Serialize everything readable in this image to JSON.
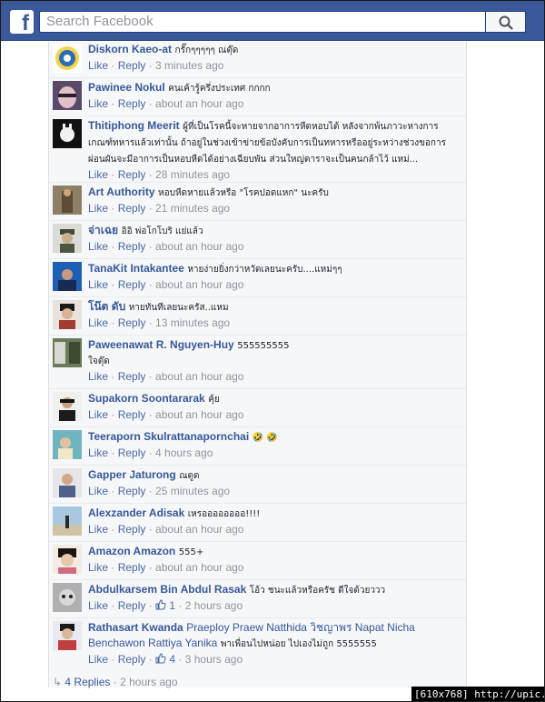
{
  "header": {
    "logo": "f",
    "search_placeholder": "Search Facebook"
  },
  "comments": [
    {
      "author": "Diskorn Kaeo-at",
      "text": "กรั๊กๆๆๆๆๆ ณตุ๊ด",
      "like": "Like",
      "reply": "Reply",
      "time": "3 minutes ago"
    },
    {
      "author": "Pawinee Nokul",
      "text": "คนเค้ารู้ครึ่งประเทศ กกกก",
      "like": "Like",
      "reply": "Reply",
      "time": "about an hour ago"
    },
    {
      "author": "Thitiphong Meerit",
      "text": "ผู้ที่เป็นโรคนี้จะหายจากอาการหืดหอบได้ หลังจากพ้นภาวะหางการเกณฑ์ทหารแล้วเท่านั้น ถ้าอยู่ในช่วงเข้าข่ายข้อบังคับการเป็นทหารหรืออยู่ระหว่างช่วงขอการผ่อนผันจะมีอาการเป็นหอบหืดได้อย่างเฉียบพัน ส่วนใหญ่ดาราจะเป็นคนกล้าไว้ แหม่...",
      "like": "Like",
      "reply": "Reply",
      "time": "28 minutes ago"
    },
    {
      "author": "Art Authority",
      "text": "หอบหืดหายแล้วหรือ \"โรคปอดแหก\" นะครับ",
      "like": "Like",
      "reply": "Reply",
      "time": "21 minutes ago"
    },
    {
      "author": "จ่าเฉย",
      "text": "อิอิ พ่อโกโบริ แย่แล้ว",
      "like": "Like",
      "reply": "Reply",
      "time": "about an hour ago"
    },
    {
      "author": "TanaKit Intakantee",
      "text": "หายง่ายยิ่งกว่าหวัดเลยนะครับ....แหม่ๆๆ",
      "like": "Like",
      "reply": "Reply",
      "time": "about an hour ago"
    },
    {
      "author": "โน๊ต ดับ",
      "text": "หายทันทีเลยนะครัส..แหม",
      "like": "Like",
      "reply": "Reply",
      "time": "13 minutes ago"
    },
    {
      "author": "Paweenawat R. Nguyen-Huy",
      "text": "555555555",
      "text2": "ใจตุ๊ด",
      "like": "Like",
      "reply": "Reply",
      "time": "about an hour ago"
    },
    {
      "author": "Supakorn Soontararak",
      "text": "คุ้ย",
      "like": "Like",
      "reply": "Reply",
      "time": "about an hour ago"
    },
    {
      "author": "Teeraporn Skulrattanapornchai",
      "text": "🤣 🤣",
      "like": "Like",
      "reply": "Reply",
      "time": "4 hours ago"
    },
    {
      "author": "Gapper Jaturong",
      "text": "ณตูด",
      "like": "Like",
      "reply": "Reply",
      "time": "25 minutes ago"
    },
    {
      "author": "Alexzander Adisak",
      "text": "เหรออออออออ!!!!",
      "like": "Like",
      "reply": "Reply",
      "time": "about an hour ago"
    },
    {
      "author": "Amazon Amazon",
      "text": "555+",
      "like": "Like",
      "reply": "Reply",
      "time": "about an hour ago"
    },
    {
      "author": "Abdulkarsem Bin Abdul Rasak",
      "text": "โอ้ว ชนะแล้วหรือครัช ดีใจด้วยววว",
      "like": "Like",
      "reply": "Reply",
      "likes": "1",
      "time": "2 hours ago"
    },
    {
      "author": "Rathasart Kwanda",
      "tags": "Praeploy Praew Natthida วิชญาพร Napat Nicha Benchawon Rattiya Yanika",
      "text": "พาเพื่อนไปหน่อย ไปเองไม่ถูก 5555555",
      "like": "Like",
      "reply": "Reply",
      "likes": "4",
      "time": "3 hours ago"
    }
  ],
  "replies_link": "4 Replies",
  "replies_time": "2 hours ago",
  "watermark": "[610x768] http://upic.me/",
  "colors": {
    "header": "#3b5998",
    "link": "#365899",
    "meta": "#90949c"
  }
}
